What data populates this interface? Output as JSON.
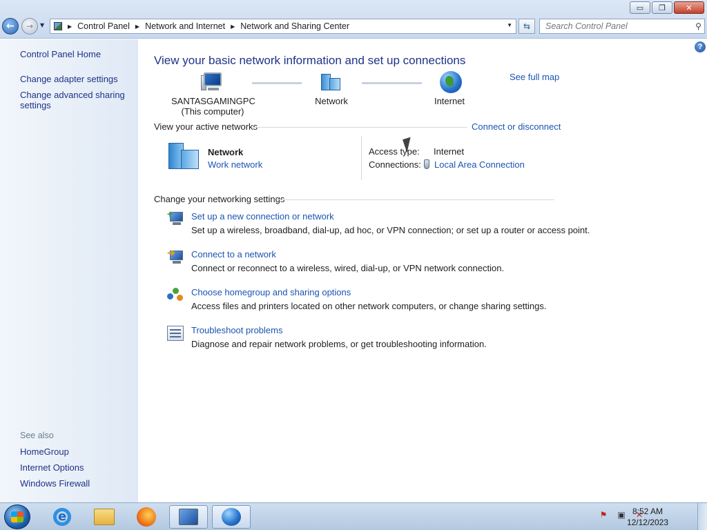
{
  "window": {
    "minimize": "▭",
    "restore": "❐",
    "close": "✕"
  },
  "address": {
    "crumbs": [
      "Control Panel",
      "Network and Internet",
      "Network and Sharing Center"
    ]
  },
  "search": {
    "placeholder": "Search Control Panel"
  },
  "sidebar": {
    "home": "Control Panel Home",
    "links": [
      "Change adapter settings",
      "Change advanced sharing settings"
    ],
    "see_also_title": "See also",
    "see_also": [
      "HomeGroup",
      "Internet Options",
      "Windows Firewall"
    ]
  },
  "main": {
    "title": "View your basic network information and set up connections",
    "see_full_map": "See full map",
    "map": {
      "computer_name": "SANTASGAMINGPC",
      "computer_sub": "(This computer)",
      "network": "Network",
      "internet": "Internet"
    },
    "active_section": "View your active networks",
    "connect_disconnect": "Connect or disconnect",
    "active": {
      "name": "Network",
      "type": "Work network",
      "access_label": "Access type:",
      "access_value": "Internet",
      "connections_label": "Connections:",
      "connections_value": "Local Area Connection"
    },
    "change_section": "Change your networking settings",
    "tasks": [
      {
        "title": "Set up a new connection or network",
        "desc": "Set up a wireless, broadband, dial-up, ad hoc, or VPN connection; or set up a router or access point."
      },
      {
        "title": "Connect to a network",
        "desc": "Connect or reconnect to a wireless, wired, dial-up, or VPN network connection."
      },
      {
        "title": "Choose homegroup and sharing options",
        "desc": "Access files and printers located on other network computers, or change sharing settings."
      },
      {
        "title": "Troubleshoot problems",
        "desc": "Diagnose and repair network problems, or get troubleshooting information."
      }
    ]
  },
  "taskbar": {
    "time": "8:52 AM",
    "date": "12/12/2023"
  }
}
